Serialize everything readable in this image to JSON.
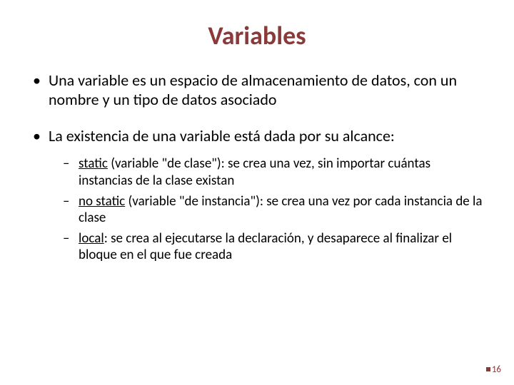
{
  "title": "Variables",
  "bullets": [
    {
      "text": "Una variable es un espacio de almacenamiento de datos, con un nombre y un tipo de datos asociado"
    },
    {
      "text": "La existencia de una variable está dada por su alcance:",
      "sub": [
        {
          "term": "static",
          "rest": " (variable \"de clase\"): se crea una vez, sin importar cuántas instancias de la clase existan"
        },
        {
          "term": "no static",
          "rest": " (variable \"de instancia\"): se crea una vez por cada instancia de la clase"
        },
        {
          "term": "local",
          "rest": ": se crea al ejecutarse la declaración, y desaparece al finalizar el bloque en el que fue creada"
        }
      ]
    }
  ],
  "page_number": "16"
}
